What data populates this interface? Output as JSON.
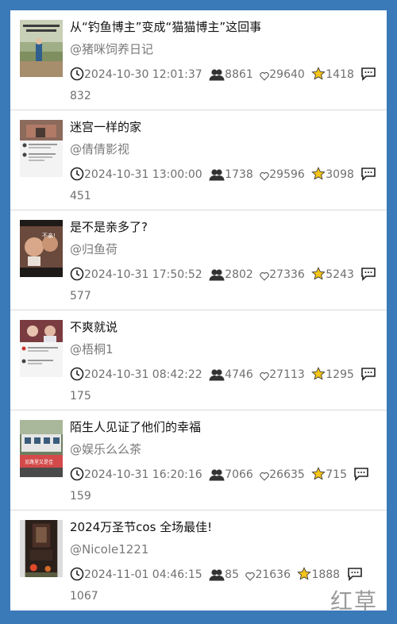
{
  "posts": [
    {
      "title": "从“钓鱼博主”变成“猫猫博主”这回事",
      "author": "@猪咪饲养日记",
      "time": "2024-10-30 12:01:37",
      "followers": "8861",
      "likes": "29640",
      "favorites": "1418",
      "comments": "832"
    },
    {
      "title": "迷宫一样的家",
      "author": "@倩倩影视",
      "time": "2024-10-31 13:00:00",
      "followers": "1738",
      "likes": "29596",
      "favorites": "3098",
      "comments": "451"
    },
    {
      "title": "是不是亲多了?",
      "author": "@归鱼荷",
      "time": "2024-10-31 17:50:52",
      "followers": "2802",
      "likes": "27336",
      "favorites": "5243",
      "comments": "577"
    },
    {
      "title": "不爽就说",
      "author": "@梧桐1",
      "time": "2024-10-31 08:42:22",
      "followers": "4746",
      "likes": "27113",
      "favorites": "1295",
      "comments": "175"
    },
    {
      "title": "陌生人见证了他们的幸福",
      "author": "@娱乐么么茶",
      "time": "2024-10-31 16:20:16",
      "followers": "7066",
      "likes": "26635",
      "favorites": "715",
      "comments": "159"
    },
    {
      "title": "2024万圣节cos 全场最佳!",
      "author": "@Nicole1221",
      "time": "2024-11-01 04:46:15",
      "followers": "85",
      "likes": "21636",
      "favorites": "1888",
      "comments": "1067"
    }
  ],
  "thumb_text": {
    "post_3": "不亲!",
    "post_5": "见路里又是佳"
  },
  "icons": {
    "time": "clock-icon",
    "followers": "users-icon",
    "likes": "heart-icon",
    "favorites": "star-icon",
    "comments": "comment-icon"
  },
  "colors": {
    "background": "#3a7ab9",
    "star": "#f5c518"
  },
  "watermark": "红草"
}
